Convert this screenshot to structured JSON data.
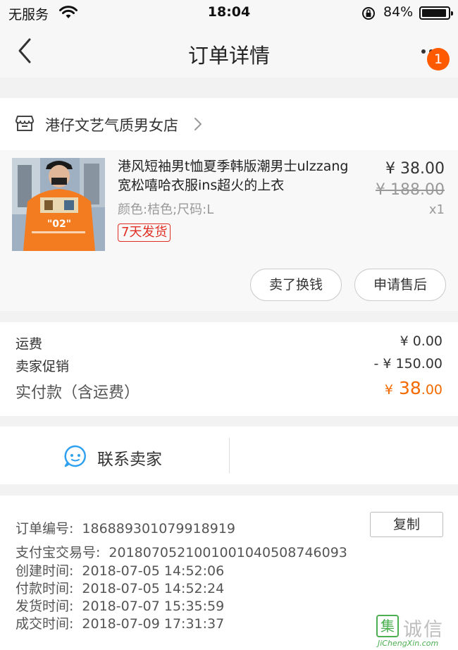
{
  "status_bar": {
    "carrier": "无服务",
    "time": "18:04",
    "battery_text": "84%",
    "battery_level": 0.84
  },
  "nav": {
    "title": "订单详情",
    "badge_count": "1",
    "back_icon": "chevron-left-icon",
    "more_icon": "more-dots-icon"
  },
  "shop": {
    "name": "港仔文艺气质男女店",
    "icon": "store-icon"
  },
  "goods": {
    "title": "港风短袖男t恤夏季韩版潮男士ulzzang宽松嘻哈衣服ins超火的上衣",
    "spec": "颜色:桔色;尺码:L",
    "tag": "7天发货",
    "price": "¥ 38.00",
    "original_price": "¥ 188.00",
    "quantity": "x1",
    "image_print": "\"02\"",
    "actions": {
      "sell": "卖了换钱",
      "after_sale": "申请售后"
    }
  },
  "fees": {
    "shipping_label": "运费",
    "shipping_value": "¥ 0.00",
    "promo_label": "卖家促销",
    "promo_value": "- ¥ 150.00",
    "total_label": "实付款（含运费）",
    "total_currency": "¥",
    "total_int": "38",
    "total_dec": ".00",
    "total_color": "#f46a00"
  },
  "contact": {
    "label": "联系卖家",
    "icon": "chat-bubble-icon"
  },
  "order": {
    "number_label": "订单编号:",
    "number": "186889301079918919",
    "copy_label": "复制",
    "alipay_label": "支付宝交易号:",
    "alipay": "2018070521001001040508746093",
    "created_label": "创建时间:",
    "created": "2018-07-05 14:52:06",
    "paid_label": "付款时间:",
    "paid": "2018-07-05 14:52:24",
    "shipped_label": "发货时间:",
    "shipped": "2018-07-07 15:35:59",
    "closed_label": "成交时间:",
    "closed": "2018-07-09 17:31:37"
  },
  "watermark": {
    "box_char": "集",
    "text": "诚信",
    "url": "JiChengXin.com"
  }
}
